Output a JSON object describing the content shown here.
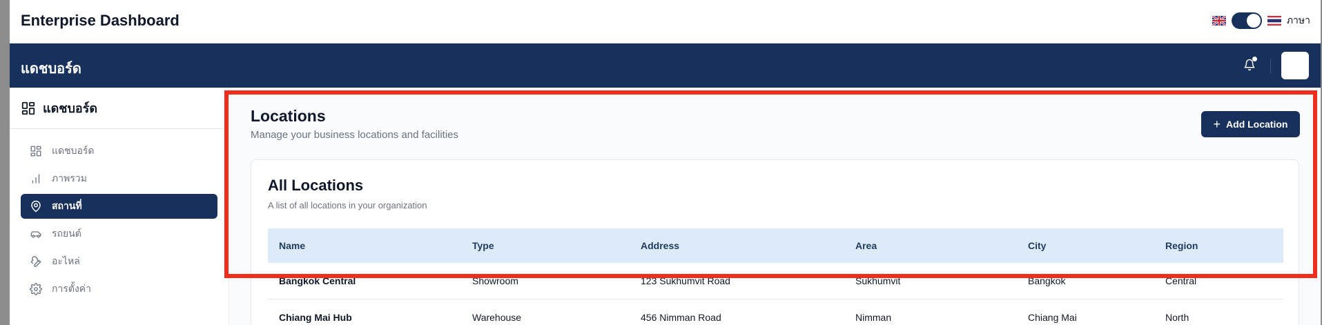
{
  "app": {
    "title": "Enterprise Dashboard",
    "language_label": "ภาษา"
  },
  "navbar": {
    "title": "แดชบอร์ด"
  },
  "sidebar": {
    "header_label": "แดชบอร์ด",
    "items": [
      {
        "label": "แดชบอร์ด",
        "icon": "dashboard-icon"
      },
      {
        "label": "ภาพรวม",
        "icon": "bar-chart-icon"
      },
      {
        "label": "สถานที่",
        "icon": "map-pin-icon",
        "active": true
      },
      {
        "label": "รถยนต์",
        "icon": "car-icon"
      },
      {
        "label": "อะไหล่",
        "icon": "wrench-icon"
      },
      {
        "label": "การตั้งค่า",
        "icon": "gear-icon"
      }
    ]
  },
  "main": {
    "title": "Locations",
    "subtitle": "Manage your business locations and facilities",
    "add_button_label": "Add Location",
    "card": {
      "title": "All Locations",
      "subtitle": "A list of all locations in your organization",
      "columns": [
        "Name",
        "Type",
        "Address",
        "Area",
        "City",
        "Region"
      ],
      "rows": [
        [
          "Bangkok Central",
          "Showroom",
          "123 Sukhumvit Road",
          "Sukhumvit",
          "Bangkok",
          "Central"
        ],
        [
          "Chiang Mai Hub",
          "Warehouse",
          "456 Nimman Road",
          "Nimman",
          "Chiang Mai",
          "North"
        ]
      ]
    }
  },
  "colors": {
    "primary": "#17305c",
    "highlight": "#f02d1c",
    "table_header_bg": "#dcebf7"
  }
}
